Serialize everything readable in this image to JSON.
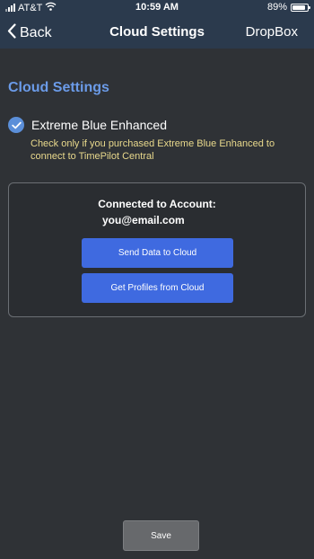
{
  "status_bar": {
    "carrier": "AT&T",
    "time": "10:59 AM",
    "battery_percent": "89%",
    "battery_level": 0.89,
    "icons": [
      "signal-icon",
      "wifi-icon",
      "battery-icon"
    ]
  },
  "nav": {
    "back_label": "Back",
    "title": "Cloud Settings",
    "right_label": "DropBox"
  },
  "section": {
    "title": "Cloud Settings"
  },
  "option": {
    "label": "Extreme Blue Enhanced",
    "checked": true,
    "hint": "Check only if you purchased Extreme Blue Enhanced to connect to TimePilot Central"
  },
  "account": {
    "label": "Connected to Account:",
    "email": "you@email.com",
    "send_label": "Send Data to Cloud",
    "get_label": "Get Profiles from Cloud"
  },
  "footer": {
    "save_label": "Save"
  },
  "colors": {
    "background": "#2f3236",
    "nav_bar": "#2b3a4d",
    "accent_blue": "#3f6ae0",
    "section_title": "#6b9be8",
    "hint_text": "#e9d98c",
    "save_button": "#67696c"
  }
}
